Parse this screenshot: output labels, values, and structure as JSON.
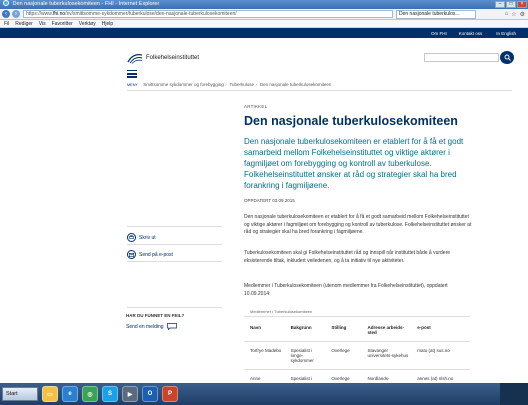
{
  "window": {
    "title": "Den nasjonale tuberkulosekomiteen - FHI - Internet Explorer",
    "url_prefix": "https://www.",
    "url_host": "fhi.no",
    "url_path": "/sv/smittsomme-sykdommer/tuberkulose/den-nasjonale-tuberkulosekomiteen/",
    "tab_label": "Den nasjonale tuberkulos..."
  },
  "menubar": [
    "Fil",
    "Rediger",
    "Vis",
    "Favoritter",
    "Verktøy",
    "Hjelp"
  ],
  "topnav": [
    "Om FHI",
    "Kontakt oss",
    "In English"
  ],
  "site": {
    "logo_text": "Folkehelseinstituttet",
    "menu_label": "MENY"
  },
  "breadcrumb": [
    "Smittsomme sykdommer og forebygging",
    "Tuberkulose",
    "Den nasjonale tuberkulosekomiteen"
  ],
  "article": {
    "kicker": "ARTIKKEL",
    "title": "Den nasjonale tuberkulosekomiteen",
    "lead": "Den nasjonale tuberkulosekomiteen er etablert for å få et godt samarbeid mellom Folkehelseinstituttet og viktige aktører i fagmiljøet om forebygging og kontroll av tuberkulose. Folkehelseinstituttet ønsker at råd og strategier skal ha bred forankring i fagmiljøene.",
    "updated": "OPPDATERT 03.09.2015",
    "p1": "Den nasjonale tuberkulosekomiteen er etablert for å få et godt samarbeid mellom Folkehelseinstituttet og viktige aktører i fagmiljøet om forebygging og kontroll av tuberkulose. Folkehelseinstituttet ønsker at råd og strategier skal ha bred forankring i fagmiljøene.",
    "p2": "Tuberkulosekomiteen skal gi Folkehelseinstituttet råd og innspill når instituttet både å vurdere eksisterende tiltak, inkludert veiledenen, og å ta initiativ til nye aktiviteter.",
    "p3": "Medlemmer i Tuberkulosekomiteen (utenom medlemmer fra Folkehelseinstituttet), oppdatert 10.09.2014:"
  },
  "table": {
    "caption": "Medlemmer i Tuberkulosekomiteen",
    "headers": [
      "Navn",
      "Bakgrunn",
      "Stilling",
      "Adresse arbeids-sted",
      "e-post"
    ],
    "rows": [
      [
        "Torfrye Madebo",
        "Spesialist i lunge-sykdommer",
        "Overlege",
        "Stavanger universitets-sykehus",
        "mato (at) sus.no"
      ],
      [
        "Anne",
        "Spesialist i",
        "Overlege",
        "Nordlands-",
        "annes (at) nlsh.no"
      ]
    ]
  },
  "sidebar": {
    "print_label": "Skriv ut",
    "email_label": "Send på e-post",
    "found_error_heading": "HAR DU FUNNET EN FEIL?",
    "send_message_label": "Send en melding"
  },
  "taskbar": {
    "start_label": "Start"
  },
  "colors": {
    "brand_navy": "#00306b",
    "lead_teal": "#00708a",
    "title_navy": "#003262"
  }
}
